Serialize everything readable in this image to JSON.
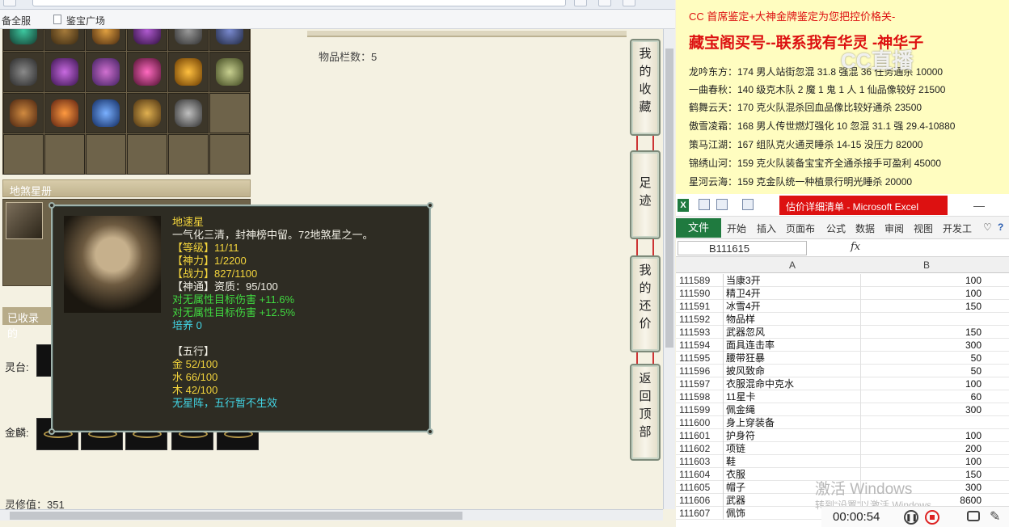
{
  "browser": {
    "bookmarks": [
      "备全服",
      "鉴宝广场"
    ]
  },
  "game": {
    "item_count_label": "物品栏数：5",
    "section_title": "地煞星册",
    "collected_label": "已收录的",
    "side_buttons": [
      {
        "chars": [
          "我",
          "的",
          "收",
          "藏"
        ]
      },
      {
        "chars": [
          "足",
          "迹"
        ]
      },
      {
        "chars": [
          "我",
          "的",
          "还",
          "价"
        ]
      },
      {
        "chars": [
          "返",
          "回",
          "顶",
          "部"
        ]
      }
    ],
    "lingtai_label": "灵台:",
    "jinlin_label": "金麟:",
    "spirit_value": "灵修值：351",
    "tooltip": {
      "name": "地速星",
      "desc": "一气化三清，封神榜中留。72地煞星之一。",
      "level": "【等级】11/11",
      "divine": "【神力】1/2200",
      "combat": "【战力】827/1100",
      "talent": "【神通】资质：95/100",
      "bonus1": "对无属性目标伤害 +11.6%",
      "bonus2": "对无属性目标伤害 +12.5%",
      "cultivate": "培养 0",
      "wuxing": "【五行】",
      "metal": "金 52/100",
      "water": "水 66/100",
      "wood": "木 42/100",
      "formation": "无星阵，五行暂不生效"
    }
  },
  "doc": {
    "lines": [
      "CC 首席鉴定+大神金牌鉴定为您把控价格关-",
      "藏宝阁买号--联系我有华灵 -神华子",
      "龙吟东方：174 男人站街忽混 31.8 强混 36 任务通杀 10000",
      "一曲春秋：140 级克木队 2 魔 1 鬼 1 人 1 仙品像较好 21500",
      "鹤舞云天：170 克火队混杀回血品像比较好通杀 23500",
      "傲雪凌霜：168 男人传世燃灯强化 10 忽混 31.1 强 29.4-10880",
      "策马江湖：167 组队克火通灵睡杀 14-15 没压力 82000",
      "锦绣山河：159 克火队装备宝宝齐全通杀接手可盈利 45000",
      "星河云海：159 克金队统一种植景行明光睡杀 20000"
    ],
    "watermark": "CC直播"
  },
  "excel": {
    "title": "估价详细清单 - Microsoft Excel",
    "tabs": [
      "开始",
      "插入",
      "页面布",
      "公式",
      "数据",
      "审阅",
      "视图",
      "开发工"
    ],
    "file_tab": "文件",
    "name_box": "B111615",
    "fx": "fx",
    "col_a": "A",
    "col_b": "B",
    "rows": [
      {
        "n": "111589",
        "a": "当康3开",
        "b": "100"
      },
      {
        "n": "111590",
        "a": "精卫4开",
        "b": "100"
      },
      {
        "n": "111591",
        "a": "冰雪4开",
        "b": "150"
      },
      {
        "n": "111592",
        "a": "物品样",
        "b": ""
      },
      {
        "n": "111593",
        "a": "武器忽风",
        "b": "150"
      },
      {
        "n": "111594",
        "a": "面具连击率",
        "b": "300"
      },
      {
        "n": "111595",
        "a": "腰带狂暴",
        "b": "50"
      },
      {
        "n": "111596",
        "a": "披风致命",
        "b": "50"
      },
      {
        "n": "111597",
        "a": "衣服混命中克水",
        "b": "100"
      },
      {
        "n": "111598",
        "a": "11星卡",
        "b": "60"
      },
      {
        "n": "111599",
        "a": "佩金绳",
        "b": "300"
      },
      {
        "n": "111600",
        "a": "身上穿装备",
        "b": ""
      },
      {
        "n": "111601",
        "a": "护身符",
        "b": "100"
      },
      {
        "n": "111602",
        "a": "项链",
        "b": "200"
      },
      {
        "n": "111603",
        "a": "鞋",
        "b": "100"
      },
      {
        "n": "111604",
        "a": "衣服",
        "b": "150"
      },
      {
        "n": "111605",
        "a": "帽子",
        "b": "300"
      },
      {
        "n": "111606",
        "a": "武器",
        "b": "8600"
      },
      {
        "n": "111607",
        "a": "佩饰",
        "b": ""
      }
    ],
    "activate_title": "激活 Windows",
    "activate_sub": "转到“设置”以激活 Windows。"
  },
  "recorder": {
    "time": "00:00:54"
  },
  "colors": {
    "excel_green": "#1f7a3f",
    "title_red": "#dd1111",
    "tooltip_bg": "#2e2c23"
  }
}
